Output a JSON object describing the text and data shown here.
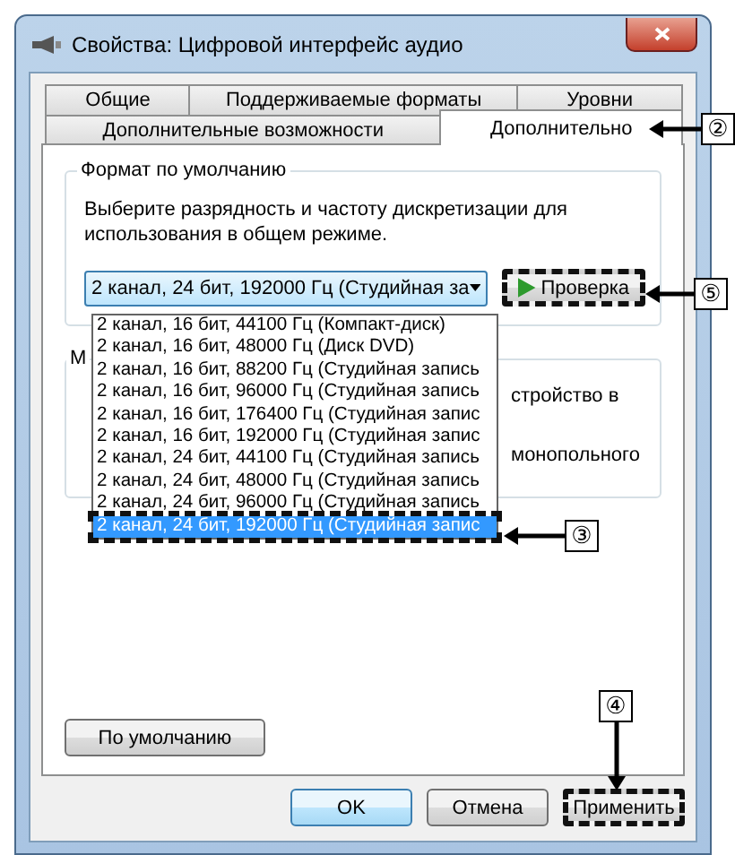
{
  "window": {
    "title": "Свойства: Цифровой интерфейс аудио"
  },
  "tabs_row_1": [
    {
      "label": "Общие",
      "selected": false
    },
    {
      "label": "Поддерживаемые форматы",
      "selected": false
    },
    {
      "label": "Уровни",
      "selected": false
    }
  ],
  "tabs_row_2": [
    {
      "label": "Дополнительные возможности",
      "selected": false
    },
    {
      "label": "Дополнительно",
      "selected": true
    }
  ],
  "default_format": {
    "title": "Формат по умолчанию",
    "description": "Выберите разрядность и частоту дискретизации для использования в общем режиме.",
    "dropdown": {
      "value": "2 канал, 24 бит, 192000 Гц (Студийная за",
      "expanded": true,
      "options": [
        {
          "label": "2 канал, 16 бит, 44100 Гц (Компакт-диск)",
          "selected": false
        },
        {
          "label": "2 канал, 16 бит, 48000 Гц (Диск DVD)",
          "selected": false
        },
        {
          "label": "2 канал, 16 бит, 88200 Гц (Студийная запись",
          "selected": false
        },
        {
          "label": "2 канал, 16 бит, 96000 Гц (Студийная запись",
          "selected": false
        },
        {
          "label": "2 канал, 16 бит, 176400 Гц (Студийная запис",
          "selected": false
        },
        {
          "label": "2 канал, 16 бит, 192000 Гц (Студийная запис",
          "selected": false
        },
        {
          "label": "2 канал, 24 бит, 44100 Гц (Студийная запись",
          "selected": false
        },
        {
          "label": "2 канал, 24 бит, 48000 Гц (Студийная запись",
          "selected": false
        },
        {
          "label": "2 канал, 24 бит, 96000 Гц (Студийная запись",
          "selected": false
        },
        {
          "label": "2 канал, 24 бит, 192000 Гц (Студийная запис",
          "selected": true
        }
      ]
    },
    "test_button": {
      "label": "Проверка",
      "highlighted": true
    }
  },
  "exclusive_group": {
    "title": "М",
    "lines": [
      "стройство в",
      "монопольного"
    ]
  },
  "defaults_button": {
    "label": "По умолчанию",
    "highlighted": false
  },
  "buttons": [
    {
      "label": "OK",
      "kind": "default",
      "highlighted": false
    },
    {
      "label": "Отмена",
      "kind": "normal",
      "highlighted": false
    },
    {
      "label": "Применить",
      "kind": "normal",
      "highlighted": true
    }
  ],
  "callouts": [
    "②",
    "⑤",
    "③",
    "④"
  ]
}
